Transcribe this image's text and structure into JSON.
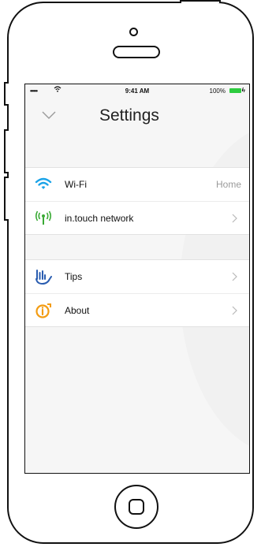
{
  "status_bar": {
    "signal": "•••••",
    "time": "9:41 AM",
    "battery_percent": "100%"
  },
  "nav": {
    "back_icon": "chevron-down-icon",
    "title": "Settings"
  },
  "sections": [
    {
      "items": [
        {
          "icon": "wifi-icon",
          "label": "Wi-Fi",
          "value": "Home",
          "chevron": false
        },
        {
          "icon": "network-antenna-icon",
          "label": "in.touch network",
          "value": "",
          "chevron": true
        }
      ]
    },
    {
      "items": [
        {
          "icon": "hand-gesture-icon",
          "label": "Tips",
          "value": "",
          "chevron": true
        },
        {
          "icon": "info-icon",
          "label": "About",
          "value": "",
          "chevron": true
        }
      ]
    }
  ],
  "colors": {
    "wifi": "#1aa3e8",
    "network": "#3aaa35",
    "tips": "#2a5db0",
    "about": "#f39c12",
    "battery": "#2ecc40"
  }
}
